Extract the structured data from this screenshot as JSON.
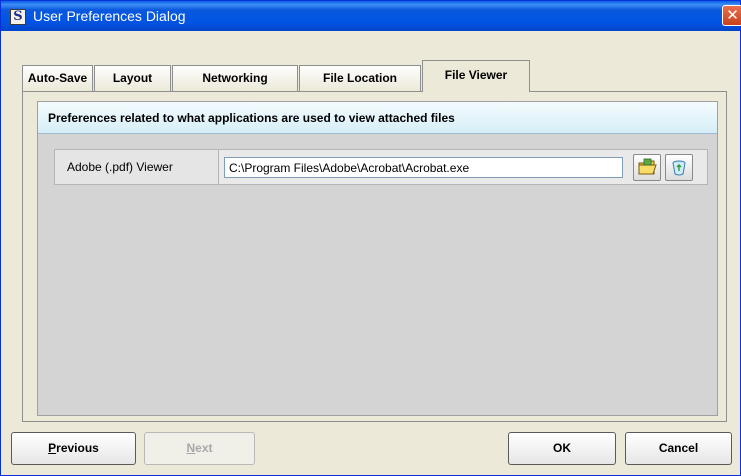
{
  "window": {
    "app_icon_letter": "S",
    "title": "User Preferences Dialog",
    "close_glyph": "✕"
  },
  "tabs": [
    {
      "label": "Auto-Save",
      "active": false
    },
    {
      "label": "Layout",
      "active": false
    },
    {
      "label": "Networking",
      "active": false
    },
    {
      "label": "File Location",
      "active": false
    },
    {
      "label": "File Viewer",
      "active": true
    }
  ],
  "panel": {
    "description": "Preferences related to what applications are used to view attached files",
    "viewer_row": {
      "label": "Adobe (.pdf) Viewer",
      "path_value": "C:\\Program Files\\Adobe\\Acrobat\\Acrobat.exe",
      "browse_icon": "folder-icon",
      "clear_icon": "recycle-bin-icon"
    }
  },
  "buttons": {
    "previous": {
      "first": "P",
      "rest": "revious",
      "enabled": true
    },
    "next": {
      "first": "N",
      "rest": "ext",
      "enabled": false
    },
    "ok": "OK",
    "cancel": "Cancel"
  }
}
